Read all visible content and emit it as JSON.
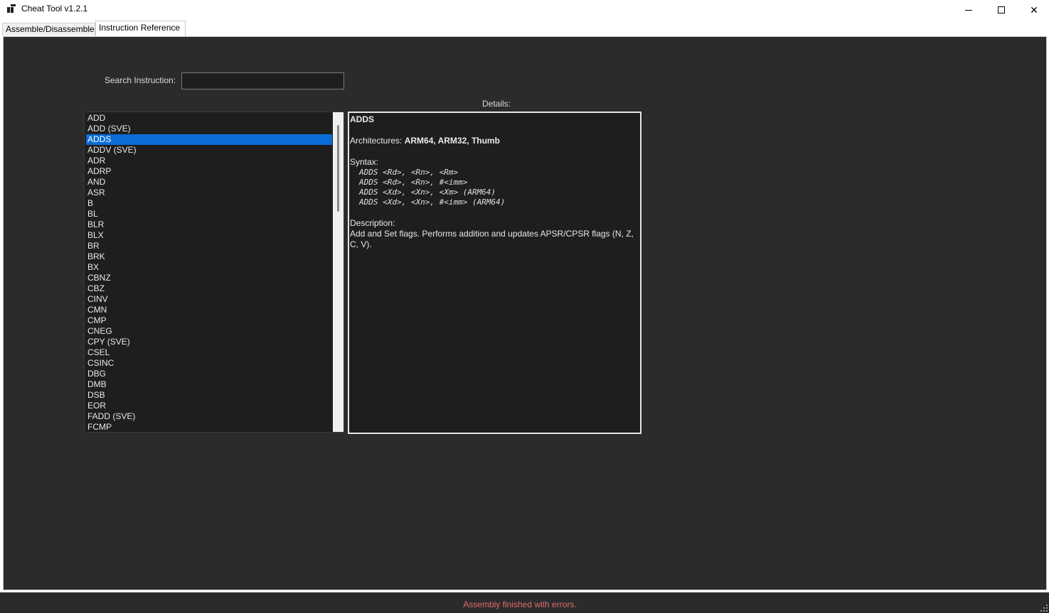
{
  "window": {
    "title": "Cheat Tool v1.2.1",
    "minimize_icon": "minimize-icon",
    "maximize_icon": "maximize-icon",
    "close_icon": "close-icon",
    "close_glyph": "✕"
  },
  "tabs": [
    {
      "label": "Assemble/Disassemble",
      "active": false
    },
    {
      "label": "Instruction Reference",
      "active": true
    }
  ],
  "search": {
    "label": "Search Instruction:",
    "value": "",
    "placeholder": ""
  },
  "details_label": "Details:",
  "instructions": {
    "selected": "ADDS",
    "items": [
      "ADD",
      "ADD (SVE)",
      "ADDS",
      "ADDV (SVE)",
      "ADR",
      "ADRP",
      "AND",
      "ASR",
      "B",
      "BL",
      "BLR",
      "BLX",
      "BR",
      "BRK",
      "BX",
      "CBNZ",
      "CBZ",
      "CINV",
      "CMN",
      "CMP",
      "CNEG",
      "CPY (SVE)",
      "CSEL",
      "CSINC",
      "DBG",
      "DMB",
      "DSB",
      "EOR",
      "FADD (SVE)",
      "FCMP"
    ]
  },
  "details": {
    "title": "ADDS",
    "architectures_label": "Architectures:",
    "architectures_value": "ARM64, ARM32, Thumb",
    "syntax_label": "Syntax:",
    "syntax_lines": [
      "ADDS <Rd>, <Rn>, <Rm>",
      "ADDS <Rd>, <Rn>, #<imm>",
      "ADDS <Xd>, <Xn>, <Xm> (ARM64)",
      "ADDS <Xd>, <Xn>, #<imm> (ARM64)"
    ],
    "description_label": "Description:",
    "description_text": "Add and Set flags. Performs addition and updates APSR/CPSR flags (N, Z, C, V)."
  },
  "status": {
    "text": "Assembly finished with errors.",
    "color": "#e46a6a"
  },
  "colors": {
    "panel_bg": "#2b2b2d",
    "list_bg": "#1e1e1e",
    "selection": "#0a6cd6"
  }
}
